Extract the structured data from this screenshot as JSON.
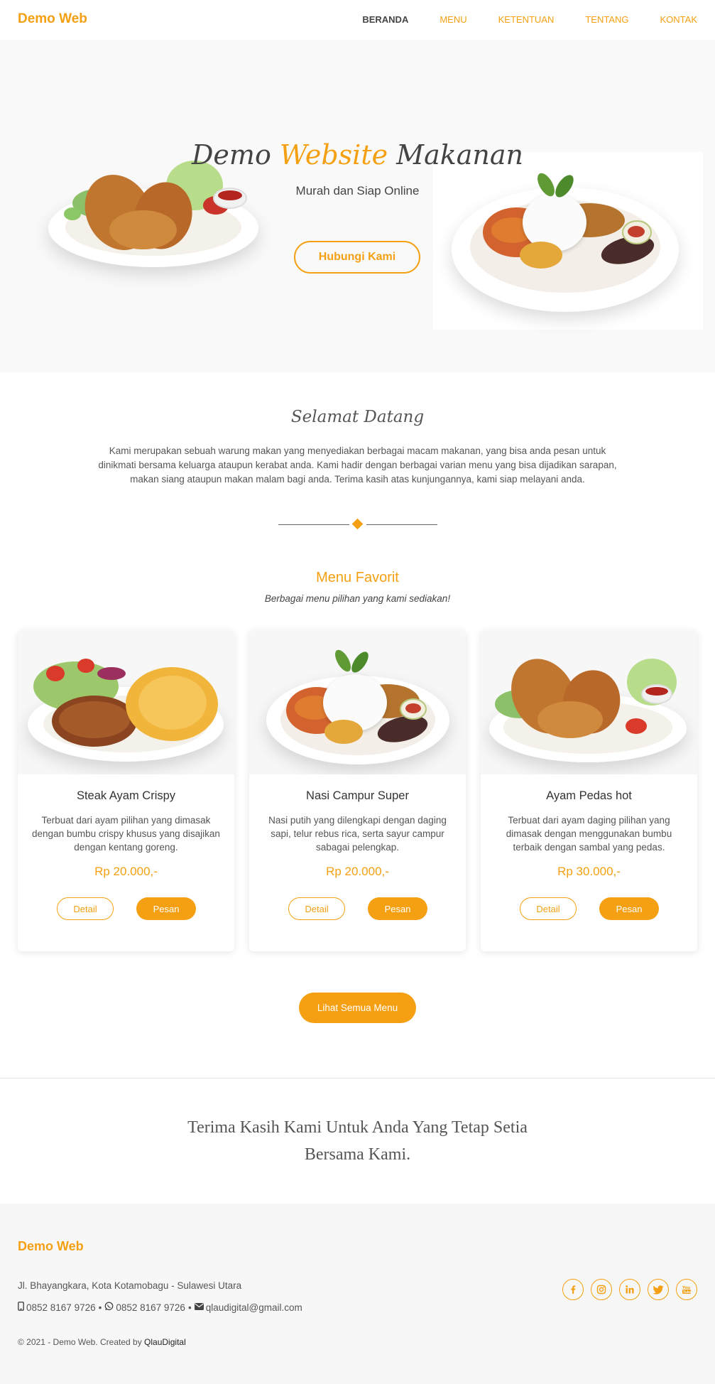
{
  "nav": {
    "brand": "Demo Web",
    "links": [
      "BERANDA",
      "MENU",
      "KETENTUAN",
      "TENTANG",
      "KONTAK"
    ]
  },
  "hero": {
    "title_part1": "Demo ",
    "title_accent": "Website",
    "title_part2": " Makanan",
    "subtitle": "Murah dan Siap Online",
    "button": "Hubungi Kami"
  },
  "welcome": {
    "title": "Selamat Datang",
    "text": "Kami merupakan sebuah warung makan yang menyediakan berbagai macam makanan, yang bisa anda pesan untuk dinikmati bersama keluarga ataupun kerabat anda. Kami hadir dengan berbagai varian menu yang bisa dijadikan sarapan, makan siang ataupun makan malam bagi anda. Terima kasih atas kunjungannya, kami siap melayani anda."
  },
  "menu": {
    "title": "Menu Favorit",
    "subtitle": "Berbagai menu pilihan yang kami sediakan!",
    "items": [
      {
        "name": "Steak Ayam Crispy",
        "desc": "Terbuat dari ayam pilihan yang dimasak dengan bumbu crispy khusus yang disajikan dengan kentang goreng.",
        "price": "Rp 20.000,-",
        "detail": "Detail",
        "order": "Pesan"
      },
      {
        "name": "Nasi Campur Super",
        "desc": "Nasi putih yang dilengkapi dengan daging sapi, telur rebus rica, serta sayur campur sabagai pelengkap.",
        "price": "Rp 20.000,-",
        "detail": "Detail",
        "order": "Pesan"
      },
      {
        "name": "Ayam Pedas hot",
        "desc": "Terbuat dari ayam daging pilihan yang dimasak dengan menggunakan bumbu terbaik dengan sambal yang pedas.",
        "price": "Rp 30.000,-",
        "detail": "Detail",
        "order": "Pesan"
      }
    ],
    "all_button": "Lihat Semua Menu"
  },
  "thanks": "Terima Kasih Kami Untuk Anda Yang Tetap Setia Bersama Kami.",
  "footer": {
    "brand": "Demo Web",
    "address": "Jl. Bhayangkara, Kota Kotamobagu - Sulawesi Utara",
    "phone1": "0852 8167 9726",
    "whatsapp": "0852 8167 9726",
    "email": "qlaudigital@gmail.com",
    "copyright": "© 2021 - Demo Web. Created by ",
    "creator": "QlauDigital",
    "socials": [
      "facebook-icon",
      "instagram-icon",
      "linkedin-icon",
      "twitter-icon",
      "youtube-icon"
    ]
  },
  "colors": {
    "accent": "#f4a012",
    "text": "#444444",
    "hero_bg": "#f9f9f9",
    "footer_bg": "#f7f7f7"
  }
}
